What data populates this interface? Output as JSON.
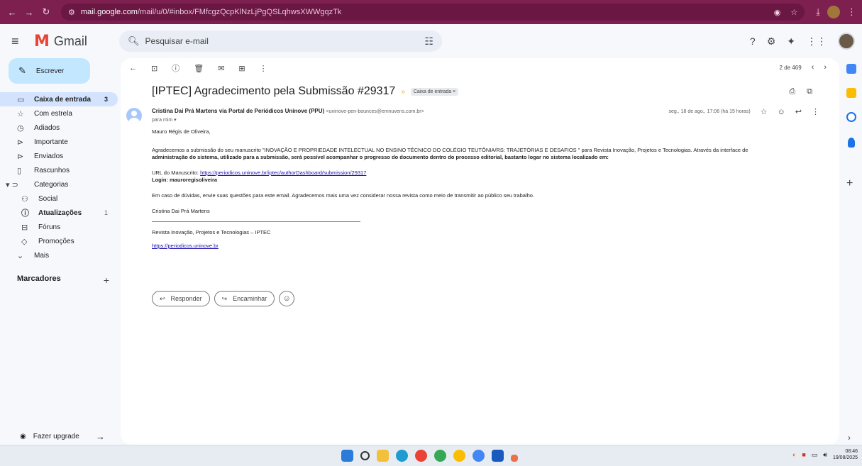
{
  "browser": {
    "host": "mail.google.com",
    "path": "/mail/u/0/#inbox/FMfcgzQcpKlNzLjPgQSLqhwsXWWgqzTk"
  },
  "app": {
    "name": "Gmail",
    "search_placeholder": "Pesquisar e-mail"
  },
  "sidebar": {
    "compose_label": "Escrever",
    "items": [
      {
        "label": "Caixa de entrada",
        "count": "3",
        "icon": "inbox-icon"
      },
      {
        "label": "Com estrela",
        "count": "",
        "icon": "star-icon"
      },
      {
        "label": "Adiados",
        "count": "",
        "icon": "clock-icon"
      },
      {
        "label": "Importante",
        "count": "",
        "icon": "important-icon"
      },
      {
        "label": "Enviados",
        "count": "",
        "icon": "send-icon"
      },
      {
        "label": "Rascunhos",
        "count": "",
        "icon": "draft-icon"
      },
      {
        "label": "Categorias",
        "count": "",
        "icon": "label-icon"
      },
      {
        "label": "Social",
        "count": "",
        "icon": "people-icon"
      },
      {
        "label": "Atualizações",
        "count": "1",
        "icon": "info-icon"
      },
      {
        "label": "Fóruns",
        "count": "",
        "icon": "forum-icon"
      },
      {
        "label": "Promoções",
        "count": "",
        "icon": "tag-icon"
      },
      {
        "label": "Mais",
        "count": "",
        "icon": "chevron-down-icon"
      }
    ],
    "markers_label": "Marcadores",
    "upgrade_label": "Fazer upgrade"
  },
  "toolbar": {
    "pager": "2 de 469"
  },
  "email": {
    "subject": "[IPTEC] Agradecimento pela Submissão #29317",
    "label": "Caixa de entrada ×",
    "sender_name": "Cristina Dai Prá Martens via Portal de Periódicos Uninove (PPU)",
    "sender_email": "<uninove-pen-bounces@emnuvens.com.br>",
    "to": "para mim ▾",
    "date": "seg., 18 de ago., 17:06 (há 15 horas)",
    "greeting": "Mauro Régis de Oliveira,",
    "para1_a": "Agradecemos a submissão do seu manuscrito \"INOVAÇÃO E PROPRIEDADE INTELECTUAL NO ENSINO TÉCNICO DO COLÉGIO TEUTÔNIA/RS: TRAJETÓRIAS E DESAFIOS \" para Revista Inovação, Projetos e Tecnologias. Através da interface de",
    "para1_b": "administração do sistema, utilizado para a submissão, será possível acompanhar o progresso do documento dentro do processo editorial, bastanto logar no sistema localizado em:",
    "url_label": "URL do Manuscrito: ",
    "url": "https://periodicos.uninove.br/iptec/authorDashboard/submission/29317",
    "login": "Login: mauroregisoliveira",
    "para2": "Em caso de dúvidas, envie suas questões para este email. Agradecemos mais uma vez considerar nossa revista como meio de transmitir ao público seu trabalho.",
    "signature": "Cristina Dai Prá Martens",
    "journal": "Revista Inovação, Projetos e Tecnologias – IPTEC",
    "journal_url": "https://periodicos.uninove.br",
    "reply_label": "Responder",
    "forward_label": "Encaminhar"
  },
  "taskbar": {
    "time": "08:46",
    "date": "19/08/2025"
  },
  "colors": {
    "chrome": "#7d1f4f",
    "active_nav": "#d3e3fd",
    "compose": "#c2e7ff"
  }
}
